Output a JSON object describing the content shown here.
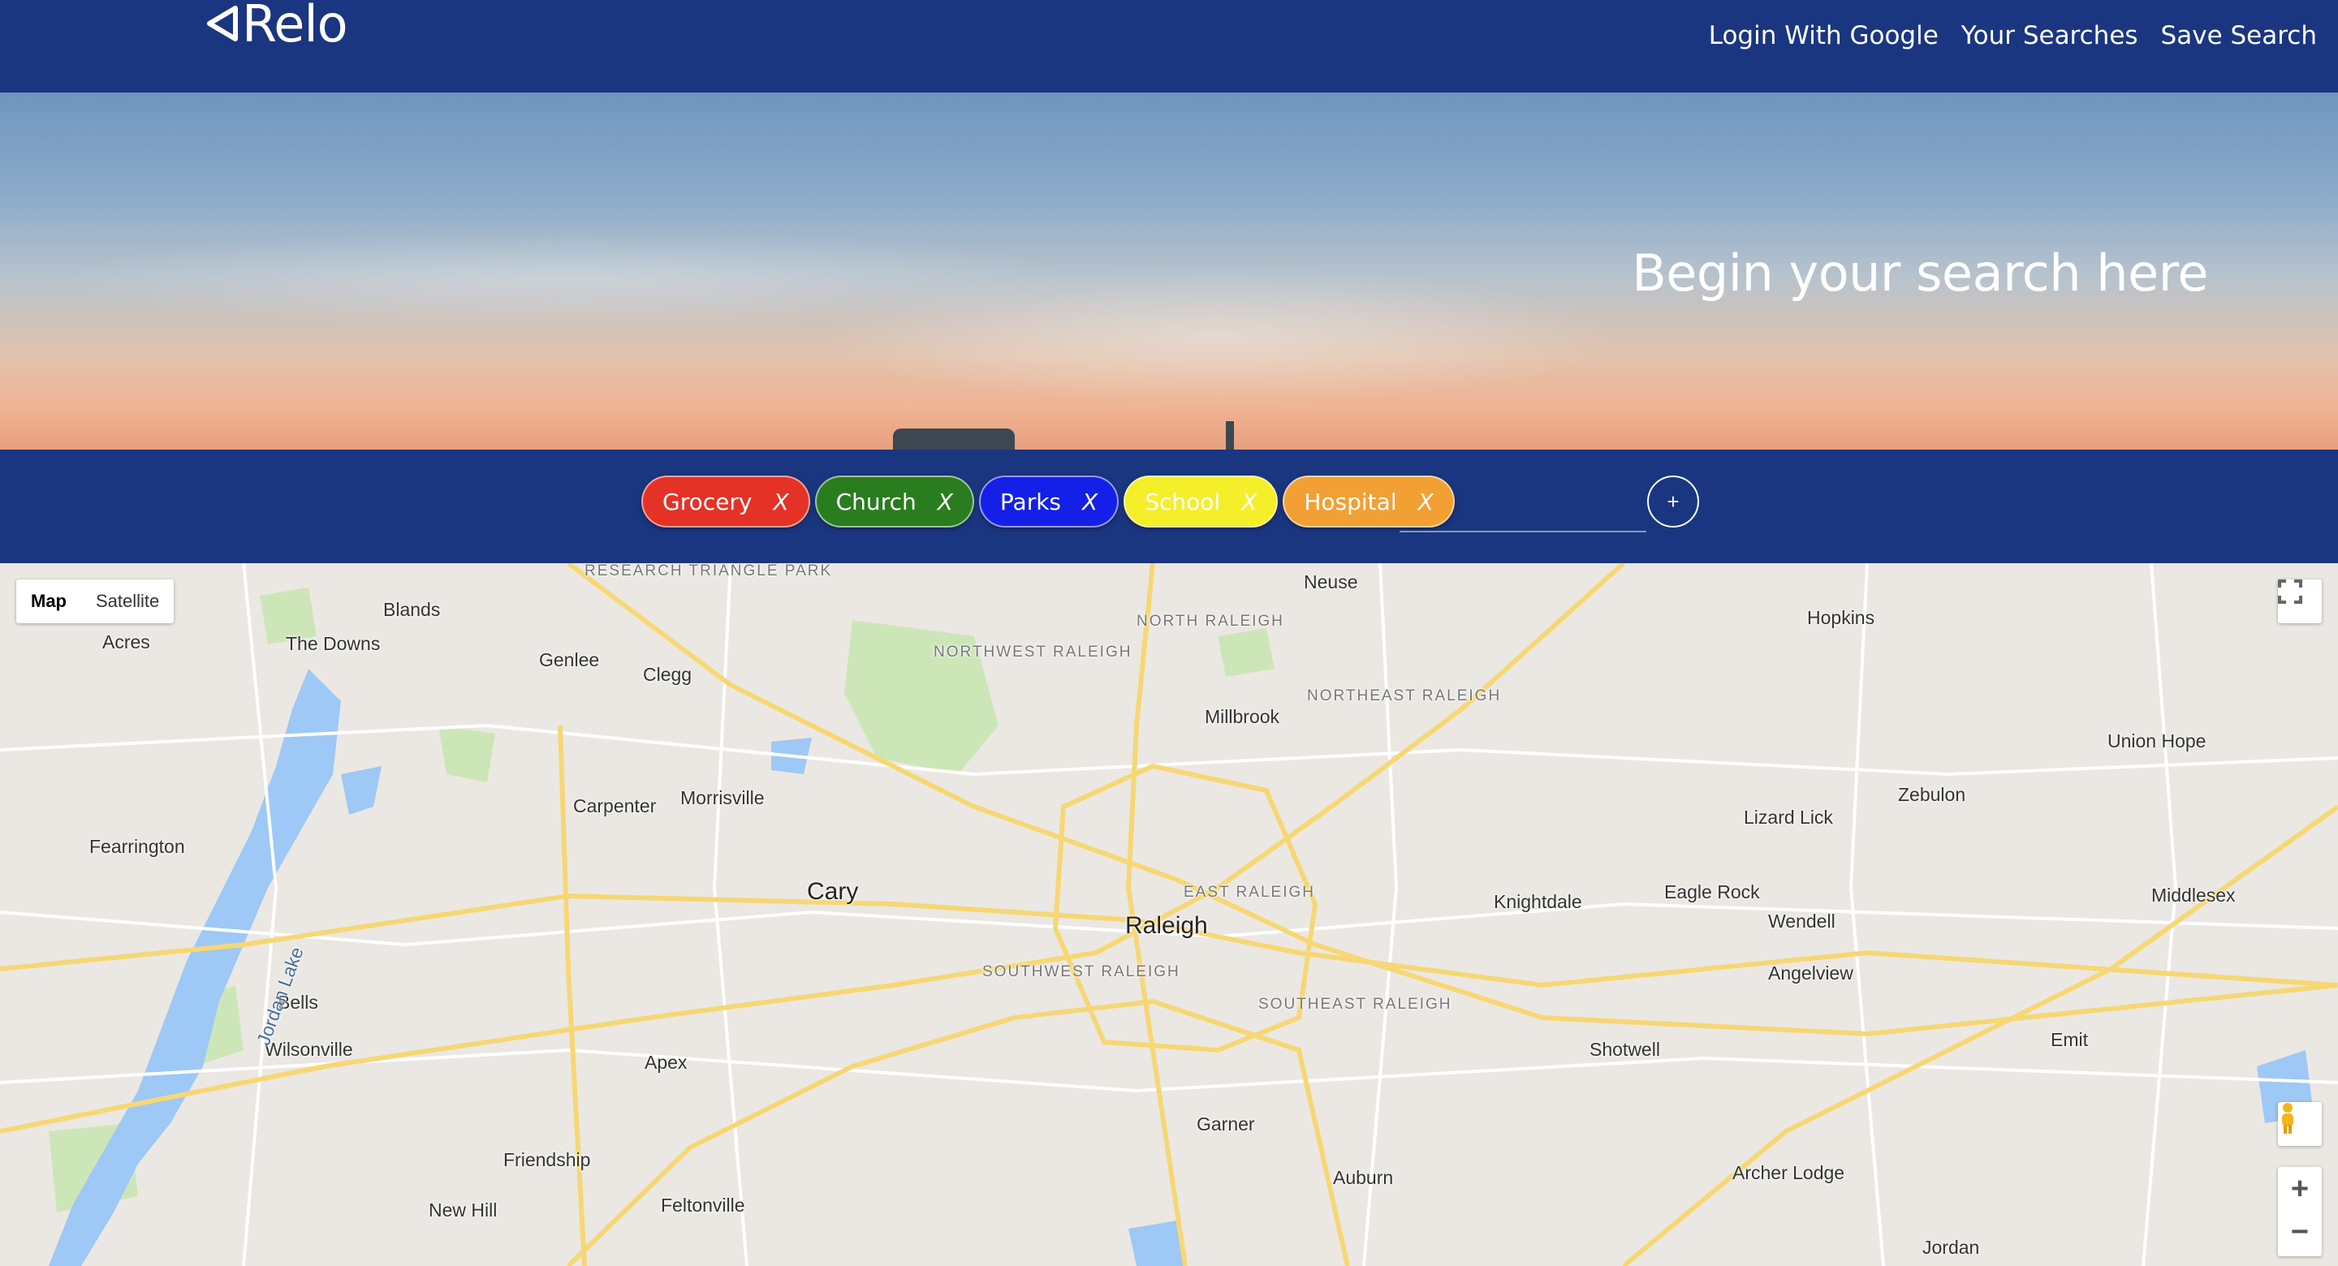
{
  "header": {
    "logo_text": "Relo",
    "nav": [
      "Login With Google",
      "Your Searches",
      "Save Search"
    ]
  },
  "hero": {
    "heading": "Begin your search here"
  },
  "filters": {
    "chips": [
      {
        "label": "Grocery",
        "color": "#e53227",
        "remove": "X"
      },
      {
        "label": "Church",
        "color": "#2a7d1f",
        "remove": "X"
      },
      {
        "label": "Parks",
        "color": "#1420e8",
        "remove": "X"
      },
      {
        "label": "School",
        "color": "#f5ef2a",
        "remove": "X"
      },
      {
        "label": "Hospital",
        "color": "#f2a034",
        "remove": "X"
      }
    ],
    "input_value": "",
    "add_label": "+"
  },
  "map": {
    "type_controls": {
      "map": "Map",
      "satellite": "Satellite"
    },
    "zoom_in": "+",
    "zoom_out": "−",
    "places": [
      {
        "name": "Raleigh",
        "kind": "big"
      },
      {
        "name": "Cary",
        "kind": "big"
      },
      {
        "name": "Blands"
      },
      {
        "name": "The Downs"
      },
      {
        "name": "Genlee"
      },
      {
        "name": "Clegg"
      },
      {
        "name": "Morrisville"
      },
      {
        "name": "Carpenter"
      },
      {
        "name": "Fearrington"
      },
      {
        "name": "Bells"
      },
      {
        "name": "Wilsonville"
      },
      {
        "name": "Apex"
      },
      {
        "name": "Friendship"
      },
      {
        "name": "New Hill"
      },
      {
        "name": "Feltonville"
      },
      {
        "name": "Garner"
      },
      {
        "name": "Auburn"
      },
      {
        "name": "Millbrook"
      },
      {
        "name": "Neuse"
      },
      {
        "name": "Hopkins"
      },
      {
        "name": "Knightdale"
      },
      {
        "name": "Eagle Rock"
      },
      {
        "name": "Wendell"
      },
      {
        "name": "Lizard Lick"
      },
      {
        "name": "Zebulon"
      },
      {
        "name": "Union Hope"
      },
      {
        "name": "Middlesex"
      },
      {
        "name": "Angelview"
      },
      {
        "name": "Shotwell"
      },
      {
        "name": "Emit"
      },
      {
        "name": "Archer Lodge"
      },
      {
        "name": "Jordan"
      },
      {
        "name": "Jordan Lake"
      },
      {
        "name": "Acres"
      },
      {
        "name": "RESEARCH TRIANGLE PARK",
        "kind": "district"
      },
      {
        "name": "NORTH RALEIGH",
        "kind": "district"
      },
      {
        "name": "NORTHWEST RALEIGH",
        "kind": "district"
      },
      {
        "name": "NORTHEAST RALEIGH",
        "kind": "district"
      },
      {
        "name": "EAST RALEIGH",
        "kind": "district"
      },
      {
        "name": "SOUTHWEST RALEIGH",
        "kind": "district"
      },
      {
        "name": "SOUTHEAST RALEIGH",
        "kind": "district"
      }
    ]
  }
}
